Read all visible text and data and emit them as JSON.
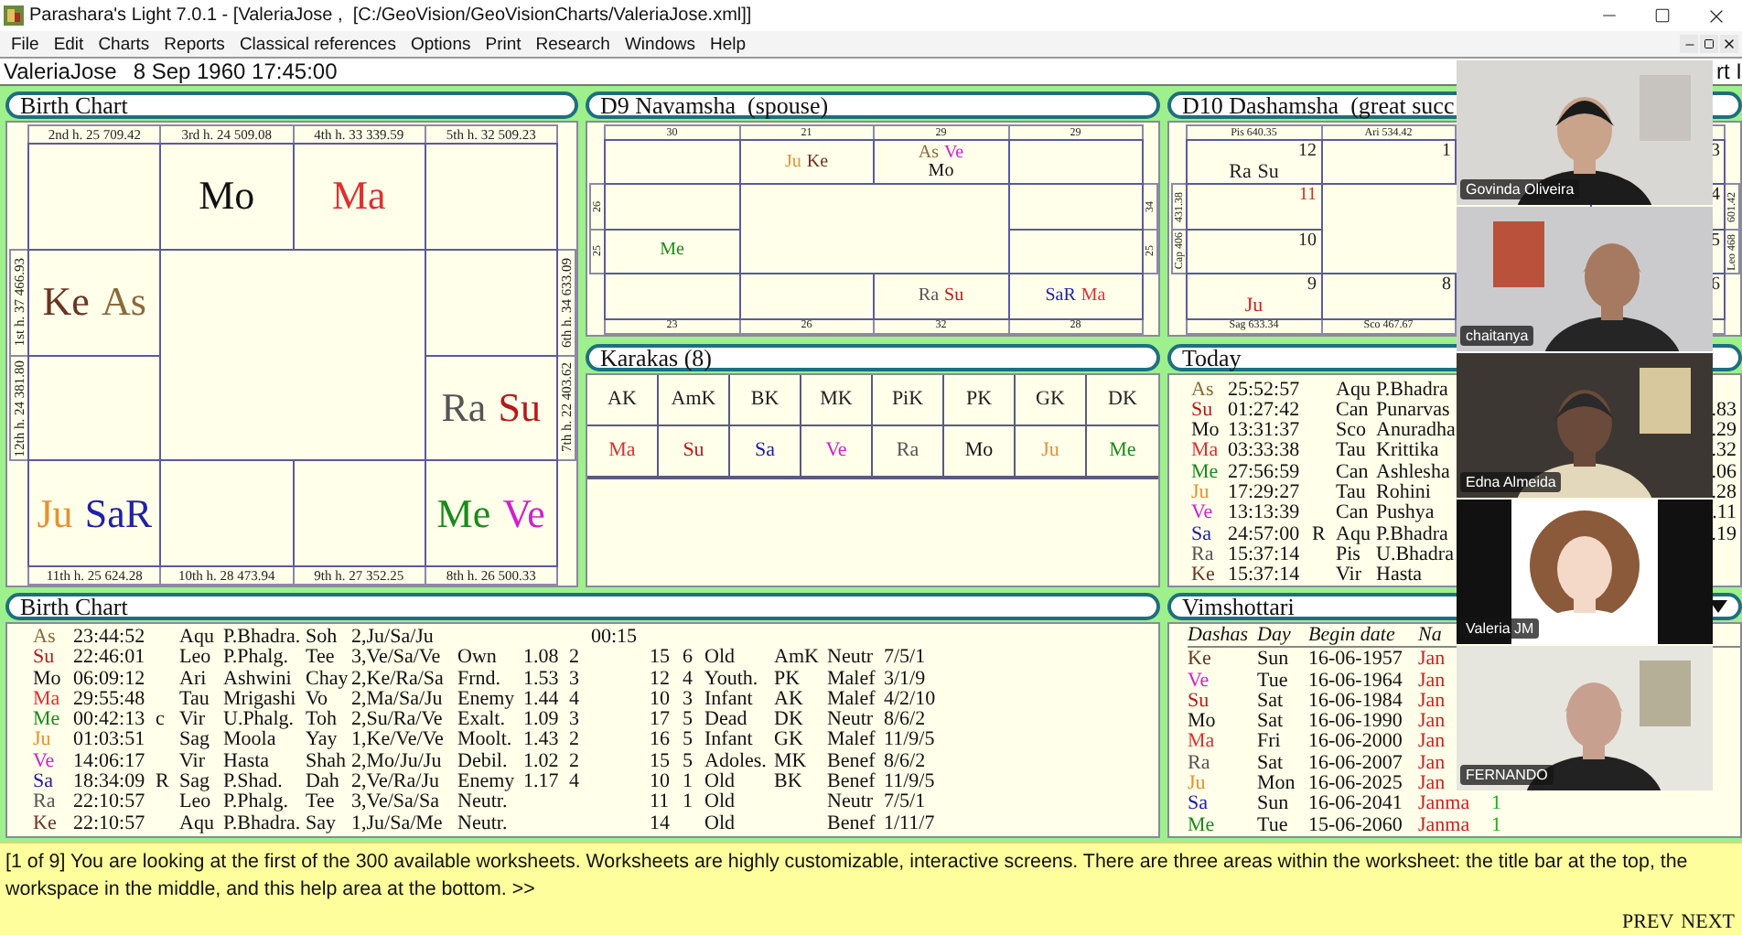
{
  "window": {
    "title": "Parashara's Light 7.0.1 - [ValeriaJose ,  [C:/GeoVision/GeoVisionCharts/ValeriaJose.xml]]"
  },
  "menu": [
    "File",
    "Edit",
    "Charts",
    "Reports",
    "Classical references",
    "Options",
    "Print",
    "Research",
    "Windows",
    "Help"
  ],
  "info_bar": {
    "chart_name": "ValeriaJose",
    "date_time": "8 Sep 1960 17:45:00",
    "right_text": "rt I"
  },
  "birth_chart": {
    "title": "Birth Chart",
    "top_labels": [
      "2nd h.  25  709.42",
      "3rd h.  24  509.08",
      "4th h.  33  339.59",
      "5th h.  32  509.23"
    ],
    "bottom_labels": [
      "11th h.  25  624.28",
      "10th h.  28  473.94",
      "9th h.  27  352.25",
      "8th h.  26  500.33"
    ],
    "left_labels": [
      "1st h.  37  466.93",
      "12th h.  24  381.80"
    ],
    "right_labels": [
      "6th h.  34  633.09",
      "7th h.  22  403.62"
    ],
    "cells": [
      {},
      {
        "lines": [
          [
            {
              "label": "Mo",
              "color": "#111111"
            }
          ]
        ]
      },
      {
        "lines": [
          [
            {
              "label": "Ma",
              "color": "#e03030"
            }
          ]
        ]
      },
      {},
      {
        "lines": [
          [
            {
              "label": "Ke",
              "color": "#6a3422"
            },
            {
              "label": "As",
              "color": "#8a6a3a"
            }
          ]
        ]
      },
      {},
      {},
      {
        "lines": [
          [
            {
              "label": "Ra",
              "color": "#555555"
            },
            {
              "label": "Su",
              "color": "#b81818"
            }
          ]
        ]
      },
      {
        "lines": [
          [
            {
              "label": "Ju",
              "color": "#e89030"
            },
            {
              "label": "SaR",
              "color": "#2020a8"
            }
          ]
        ]
      },
      {},
      {},
      {
        "lines": [
          [
            {
              "label": "Me",
              "color": "#1a8a1a"
            },
            {
              "label": "Ve",
              "color": "#d020d0"
            }
          ]
        ]
      }
    ]
  },
  "d9_chart": {
    "title": "D9 Navamsha  (spouse)",
    "top_labels": [
      "30",
      "21",
      "29",
      "29"
    ],
    "bottom_labels": [
      "23",
      "26",
      "32",
      "28"
    ],
    "left_labels": [
      "26",
      "25"
    ],
    "right_labels": [
      "34",
      "25"
    ],
    "cells": [
      {},
      {
        "lines": [
          [
            {
              "label": "Ju",
              "color": "#e89030"
            },
            {
              "label": "Ke",
              "color": "#6a3422"
            }
          ]
        ]
      },
      {
        "lines": [
          [
            {
              "label": "As",
              "color": "#8a6a3a"
            },
            {
              "label": "Ve",
              "color": "#d020d0"
            }
          ],
          [
            {
              "label": "Mo",
              "color": "#111111"
            }
          ]
        ]
      },
      {},
      {},
      {},
      {
        "lines": [
          [
            {
              "label": "Me",
              "color": "#1a8a1a"
            }
          ]
        ]
      },
      {},
      {},
      {},
      {
        "lines": [
          [
            {
              "label": "Ra",
              "color": "#555555"
            },
            {
              "label": "Su",
              "color": "#b81818"
            }
          ]
        ]
      },
      {
        "lines": [
          [
            {
              "label": "SaR",
              "color": "#2020a8"
            },
            {
              "label": "Ma",
              "color": "#e03030"
            }
          ]
        ]
      }
    ]
  },
  "d10_chart": {
    "title": "D10 Dashamsha  (great succ",
    "top_labels": [
      "Pis 640.35",
      "Ari 534.42"
    ],
    "bottom_labels": [
      "Sag 633.34",
      "Sco 467.67"
    ],
    "left_labels": [
      "431.38",
      "Cap 406"
    ],
    "right_labels": [
      "601.42",
      "Leo 468"
    ],
    "cells": [
      {
        "number": {
          "text": "12",
          "color": "#222222"
        },
        "lines": [
          [
            {
              "label": "Ra",
              "color": "#222222"
            },
            {
              "label": "Su",
              "color": "#222222"
            }
          ]
        ]
      },
      {
        "number": {
          "text": "1",
          "color": "#222222"
        }
      },
      {},
      {
        "number": {
          "text": "3",
          "color": "#222222"
        }
      },
      {
        "number": {
          "text": "11",
          "color": "#d03030"
        }
      },
      {
        "number": {
          "text": "4",
          "color": "#222222"
        }
      },
      {
        "number": {
          "text": "10",
          "color": "#222222"
        }
      },
      {
        "number": {
          "text": "5",
          "color": "#222222"
        }
      },
      {
        "number": {
          "text": "9",
          "color": "#222222"
        },
        "lines": [
          [
            {
              "label": "Ju",
              "color": "#d02020"
            }
          ]
        ]
      },
      {
        "number": {
          "text": "8",
          "color": "#222222"
        }
      },
      {},
      {
        "number": {
          "text": "6",
          "color": "#222222"
        }
      }
    ]
  },
  "karakas": {
    "title": "Karakas (8)",
    "headers": [
      "AK",
      "AmK",
      "BK",
      "MK",
      "PiK",
      "PK",
      "GK",
      "DK"
    ],
    "values": [
      {
        "label": "Ma",
        "color": "#e03030"
      },
      {
        "label": "Su",
        "color": "#b81818"
      },
      {
        "label": "Sa",
        "color": "#2020a8"
      },
      {
        "label": "Ve",
        "color": "#d020d0"
      },
      {
        "label": "Ra",
        "color": "#555555"
      },
      {
        "label": "Mo",
        "color": "#111111"
      },
      {
        "label": "Ju",
        "color": "#e89030"
      },
      {
        "label": "Me",
        "color": "#1a8a1a"
      }
    ]
  },
  "today": {
    "title": "Today",
    "rows": [
      {
        "planet": {
          "label": "As",
          "color": "#8a6a3a"
        },
        "time": "25:52:57",
        "sign": "Aqu",
        "nakshatra": "P.Bhadra"
      },
      {
        "planet": {
          "label": "Su",
          "color": "#b81818"
        },
        "time": "01:27:42",
        "sign": "Can",
        "nakshatra": "Punarvas",
        "tail": ".83"
      },
      {
        "planet": {
          "label": "Mo",
          "color": "#111111"
        },
        "time": "13:31:37",
        "sign": "Sco",
        "nakshatra": "Anuradha",
        "tail": ".29"
      },
      {
        "planet": {
          "label": "Ma",
          "color": "#e03030"
        },
        "time": "03:33:38",
        "sign": "Tau",
        "nakshatra": "Krittika",
        "tail": ".32"
      },
      {
        "planet": {
          "label": "Me",
          "color": "#1a8a1a"
        },
        "time": "27:56:59",
        "sign": "Can",
        "nakshatra": "Ashlesha",
        "tail": ".06"
      },
      {
        "planet": {
          "label": "Ju",
          "color": "#e89030"
        },
        "time": "17:29:27",
        "sign": "Tau",
        "nakshatra": "Rohini",
        "tail": ".28"
      },
      {
        "planet": {
          "label": "Ve",
          "color": "#d020d0"
        },
        "time": "13:13:39",
        "sign": "Can",
        "nakshatra": "Pushya",
        "tail": ".11"
      },
      {
        "planet": {
          "label": "Sa",
          "color": "#2020a8"
        },
        "time": "24:57:00",
        "flag": "R",
        "sign": "Aqu",
        "nakshatra": "P.Bhadra",
        "tail": ".19"
      },
      {
        "planet": {
          "label": "Ra",
          "color": "#555555"
        },
        "time": "15:37:14",
        "sign": "Pis",
        "nakshatra": "U.Bhadra"
      },
      {
        "planet": {
          "label": "Ke",
          "color": "#6a3422"
        },
        "time": "15:37:14",
        "sign": "Vir",
        "nakshatra": "Hasta"
      }
    ]
  },
  "birth_table": {
    "title": "Birth Chart",
    "rows": [
      {
        "planet": {
          "label": "As",
          "color": "#8a6a3a"
        },
        "longitude": "23:44:52",
        "sign": "Aqu",
        "nakshatra": "P.Bhadra.",
        "syllable": "Soh",
        "lords": "2,Ju/Sa/Ju",
        "col_11": "00:15"
      },
      {
        "planet": {
          "label": "Su",
          "color": "#b81818"
        },
        "longitude": "22:46:01",
        "sign": "Leo",
        "nakshatra": "P.Phalg.",
        "syllable": "Tee",
        "lords": "3,Ve/Sa/Ve",
        "relation": "Own",
        "col_9": "1.08",
        "col_10": "2",
        "col_12": "15",
        "col_13": "6",
        "age": "Old",
        "karaka": "AmK",
        "nature": "Neutr",
        "col_17": "7/5/1"
      },
      {
        "planet": {
          "label": "Mo",
          "color": "#111111"
        },
        "longitude": "06:09:12",
        "sign": "Ari",
        "nakshatra": "Ashwini",
        "syllable": "Chay",
        "lords": "2,Ke/Ra/Sa",
        "relation": "Frnd.",
        "col_9": "1.53",
        "col_10": "3",
        "col_12": "12",
        "col_13": "4",
        "age": "Youth.",
        "karaka": "PK",
        "nature": "Malef",
        "col_17": "3/1/9"
      },
      {
        "planet": {
          "label": "Ma",
          "color": "#e03030"
        },
        "longitude": "29:55:48",
        "sign": "Tau",
        "nakshatra": "Mrigashi",
        "syllable": "Vo",
        "lords": "2,Ma/Sa/Ju",
        "relation": "Enemy",
        "col_9": "1.44",
        "col_10": "4",
        "col_12": "10",
        "col_13": "3",
        "age": "Infant",
        "karaka": "AK",
        "nature": "Malef",
        "col_17": "4/2/10"
      },
      {
        "planet": {
          "label": "Me",
          "color": "#1a8a1a"
        },
        "longitude": "00:42:13",
        "flag": "c",
        "sign": "Vir",
        "nakshatra": "U.Phalg.",
        "syllable": "Toh",
        "lords": "2,Su/Ra/Ve",
        "relation": "Exalt.",
        "col_9": "1.09",
        "col_10": "3",
        "col_12": "17",
        "col_13": "5",
        "age": "Dead",
        "karaka": "DK",
        "nature": "Neutr",
        "col_17": "8/6/2"
      },
      {
        "planet": {
          "label": "Ju",
          "color": "#e89030"
        },
        "longitude": "01:03:51",
        "sign": "Sag",
        "nakshatra": "Moola",
        "syllable": "Yay",
        "lords": "1,Ke/Ve/Ve",
        "relation": "Moolt.",
        "col_9": "1.43",
        "col_10": "2",
        "col_12": "16",
        "col_13": "5",
        "age": "Infant",
        "karaka": "GK",
        "nature": "Malef",
        "col_17": "11/9/5"
      },
      {
        "planet": {
          "label": "Ve",
          "color": "#d020d0"
        },
        "longitude": "14:06:17",
        "sign": "Vir",
        "nakshatra": "Hasta",
        "syllable": "Shah",
        "lords": "2,Mo/Ju/Ju",
        "relation": "Debil.",
        "col_9": "1.02",
        "col_10": "2",
        "col_12": "15",
        "col_13": "5",
        "age": "Adoles.",
        "karaka": "MK",
        "nature": "Benef",
        "col_17": "8/6/2"
      },
      {
        "planet": {
          "label": "Sa",
          "color": "#2020a8"
        },
        "longitude": "18:34:09",
        "flag": "R",
        "sign": "Sag",
        "nakshatra": "P.Shad.",
        "syllable": "Dah",
        "lords": "2,Ve/Ra/Ju",
        "relation": "Enemy",
        "col_9": "1.17",
        "col_10": "4",
        "col_12": "10",
        "col_13": "1",
        "age": "Old",
        "karaka": "BK",
        "nature": "Benef",
        "col_17": "11/9/5"
      },
      {
        "planet": {
          "label": "Ra",
          "color": "#555555"
        },
        "longitude": "22:10:57",
        "sign": "Leo",
        "nakshatra": "P.Phalg.",
        "syllable": "Tee",
        "lords": "3,Ve/Sa/Sa",
        "relation": "Neutr.",
        "col_12": "11",
        "col_13": "1",
        "age": "Old",
        "nature": "Neutr",
        "col_17": "7/5/1"
      },
      {
        "planet": {
          "label": "Ke",
          "color": "#6a3422"
        },
        "longitude": "22:10:57",
        "sign": "Aqu",
        "nakshatra": "P.Bhadra.",
        "syllable": "Say",
        "lords": "1,Ju/Sa/Me",
        "relation": "Neutr.",
        "col_12": "14",
        "age": "Old",
        "nature": "Benef",
        "col_17": "1/11/7"
      }
    ]
  },
  "vimshottari": {
    "title": "Vimshottari",
    "columns": [
      "Dashas",
      "Day",
      "Begin date",
      "Na"
    ],
    "rows": [
      {
        "dasha": {
          "label": "Ke",
          "color": "#6a3422"
        },
        "day": "Sun",
        "date": "16-06-1957",
        "name": "Jan"
      },
      {
        "dasha": {
          "label": "Ve",
          "color": "#d020d0"
        },
        "day": "Tue",
        "date": "16-06-1964",
        "name": "Jan"
      },
      {
        "dasha": {
          "label": "Su",
          "color": "#b81818"
        },
        "day": "Sat",
        "date": "16-06-1984",
        "name": "Jan"
      },
      {
        "dasha": {
          "label": "Mo",
          "color": "#111111"
        },
        "day": "Sat",
        "date": "16-06-1990",
        "name": "Jan"
      },
      {
        "dasha": {
          "label": "Ma",
          "color": "#e03030"
        },
        "day": "Fri",
        "date": "16-06-2000",
        "name": "Jan"
      },
      {
        "dasha": {
          "label": "Ra",
          "color": "#555555"
        },
        "day": "Sat",
        "date": "16-06-2007",
        "name": "Jan"
      },
      {
        "dasha": {
          "label": "Ju",
          "color": "#e89030"
        },
        "day": "Mon",
        "date": "16-06-2025",
        "name": "Jan"
      },
      {
        "dasha": {
          "label": "Sa",
          "color": "#2020a8"
        },
        "day": "Sun",
        "date": "16-06-2041",
        "name": "Janma",
        "count": "1"
      },
      {
        "dasha": {
          "label": "Me",
          "color": "#1a8a1a"
        },
        "day": "Tue",
        "date": "15-06-2060",
        "name": "Janma",
        "count": "1"
      }
    ]
  },
  "help": {
    "text": "[1 of 9] You are looking at the first of the 300 available worksheets. Worksheets are highly customizable, interactive screens. There are three areas within the worksheet: the title bar at the top, the workspace in the middle, and this help area at the bottom. >>",
    "buttons": [
      "PREV",
      "NEXT"
    ]
  },
  "video_tiles": [
    {
      "name": "Govinda Oliveira"
    },
    {
      "name": "chaitanya"
    },
    {
      "name": "Edna Almeida"
    },
    {
      "name": "Valeria JM"
    },
    {
      "name": "FERNANDO"
    }
  ]
}
